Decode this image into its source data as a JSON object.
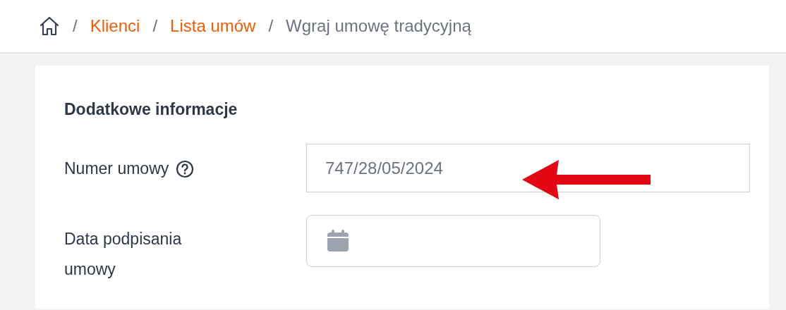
{
  "breadcrumb": [
    {
      "label": "Klienci",
      "kind": "link"
    },
    {
      "label": "Lista umów",
      "kind": "link"
    },
    {
      "label": "Wgraj umowę tradycyjną",
      "kind": "current"
    }
  ],
  "separator": "/",
  "section": {
    "title": "Dodatkowe informacje",
    "fields": [
      {
        "label": "Numer umowy",
        "kind": "text",
        "help": true,
        "value": "747/28/05/2024"
      },
      {
        "label": "Data podpisania umowy",
        "kind": "date",
        "help": false
      }
    ]
  }
}
